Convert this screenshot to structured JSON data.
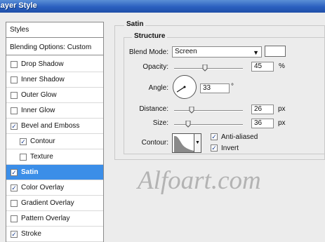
{
  "window": {
    "title": "Layer Style"
  },
  "left_panel": {
    "header": "Styles",
    "blending": "Blending Options: Custom",
    "items": [
      {
        "label": "Drop Shadow",
        "checked": false,
        "selected": false,
        "indent": false
      },
      {
        "label": "Inner Shadow",
        "checked": false,
        "selected": false,
        "indent": false
      },
      {
        "label": "Outer Glow",
        "checked": false,
        "selected": false,
        "indent": false
      },
      {
        "label": "Inner Glow",
        "checked": false,
        "selected": false,
        "indent": false
      },
      {
        "label": "Bevel and Emboss",
        "checked": true,
        "selected": false,
        "indent": false
      },
      {
        "label": "Contour",
        "checked": true,
        "selected": false,
        "indent": true
      },
      {
        "label": "Texture",
        "checked": false,
        "selected": false,
        "indent": true
      },
      {
        "label": "Satin",
        "checked": true,
        "selected": true,
        "indent": false
      },
      {
        "label": "Color Overlay",
        "checked": true,
        "selected": false,
        "indent": false
      },
      {
        "label": "Gradient Overlay",
        "checked": false,
        "selected": false,
        "indent": false
      },
      {
        "label": "Pattern Overlay",
        "checked": false,
        "selected": false,
        "indent": false
      },
      {
        "label": "Stroke",
        "checked": true,
        "selected": false,
        "indent": false
      }
    ]
  },
  "satin": {
    "section_title": "Satin",
    "group_title": "Structure",
    "blend_mode_label": "Blend Mode:",
    "blend_mode_value": "Screen",
    "blend_color": "#ffffff",
    "opacity_label": "Opacity:",
    "opacity_value": "45",
    "opacity_unit": "%",
    "opacity_level": 0.45,
    "angle_label": "Angle:",
    "angle_value": "33",
    "angle_unit": "°",
    "distance_label": "Distance:",
    "distance_value": "26",
    "distance_unit": "px",
    "distance_level": 0.26,
    "size_label": "Size:",
    "size_value": "36",
    "size_unit": "px",
    "size_level": 0.2,
    "contour_label": "Contour:",
    "anti_aliased_label": "Anti-aliased",
    "anti_aliased": true,
    "invert_label": "Invert",
    "invert": true
  },
  "watermark": "Alfoart.com"
}
